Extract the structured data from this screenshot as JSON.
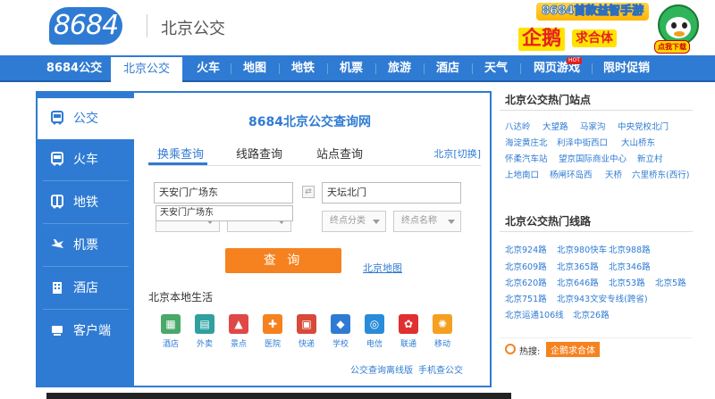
{
  "header": {
    "logo": "8684",
    "city_title": "北京公交",
    "ad": {
      "top": "8684首款益智手游",
      "big": "企鹅",
      "big2": "求合体",
      "cta": "点我下载"
    }
  },
  "nav": {
    "items": [
      {
        "label": "8684公交"
      },
      {
        "label": "北京公交"
      },
      {
        "label": "火车"
      },
      {
        "label": "地图"
      },
      {
        "label": "地铁"
      },
      {
        "label": "机票"
      },
      {
        "label": "旅游"
      },
      {
        "label": "酒店"
      },
      {
        "label": "天气"
      },
      {
        "label": "网页游戏"
      },
      {
        "label": "限时促销"
      }
    ],
    "hot_badge": "HOT"
  },
  "side": {
    "items": [
      {
        "label": "公交",
        "icon": "bus-icon"
      },
      {
        "label": "火车",
        "icon": "train-icon"
      },
      {
        "label": "地铁",
        "icon": "subway-icon"
      },
      {
        "label": "机票",
        "icon": "plane-icon"
      },
      {
        "label": "酒店",
        "icon": "hotel-icon"
      },
      {
        "label": "客户端",
        "icon": "client-icon"
      }
    ]
  },
  "main": {
    "title": "8684北京公交查询网",
    "tabs": [
      {
        "label": "换乘查询"
      },
      {
        "label": "线路查询"
      },
      {
        "label": "站点查询"
      }
    ],
    "city_switch": "北京[切换]",
    "from_value": "天安门广场东",
    "to_value": "天坛北门",
    "suggestion": "天安门广场东",
    "end_category": "终点分类",
    "end_name": "终点名称",
    "query_button": "查 询",
    "map_link": "北京地图",
    "life_title": "北京本地生活",
    "life_items": [
      {
        "label": "酒店",
        "color": "#4aa86a"
      },
      {
        "label": "外卖",
        "color": "#2fa0a0"
      },
      {
        "label": "景点",
        "color": "#e04848"
      },
      {
        "label": "医院",
        "color": "#f5821f"
      },
      {
        "label": "快递",
        "color": "#d84a3a"
      },
      {
        "label": "学校",
        "color": "#2f7bd3"
      },
      {
        "label": "电信",
        "color": "#2a8bd8"
      },
      {
        "label": "联通",
        "color": "#e03030"
      },
      {
        "label": "移动",
        "color": "#f5a020"
      }
    ],
    "offline_link": "公交查询离线版",
    "mobile_link": "手机查公交"
  },
  "right": {
    "hot_stops_title": "北京公交热门站点",
    "hot_stops": [
      [
        "八达岭",
        "大望路",
        "马家沟",
        "中央党校北门"
      ],
      [
        "海淀黄庄北",
        "利泽中街西口",
        "大山桥东"
      ],
      [
        "怀柔汽车站",
        "望京国际商业中心",
        "新立村"
      ],
      [
        "上地南口",
        "杨闸环岛西",
        "天桥",
        "六里桥东(西行)"
      ]
    ],
    "hot_lines_title": "北京公交热门线路",
    "hot_lines": [
      [
        "北京924路",
        "北京980快车",
        "北京988路"
      ],
      [
        "北京609路",
        "北京365路",
        "北京346路"
      ],
      [
        "北京620路",
        "北京646路",
        "北京53路",
        "北京5路"
      ],
      [
        "北京751路",
        "北京943文安专线(跨省)"
      ],
      [
        "北京运通106线",
        "北京26路"
      ]
    ],
    "hot_search_label": "热搜:",
    "hot_search_tag": "企鹅求合体"
  }
}
